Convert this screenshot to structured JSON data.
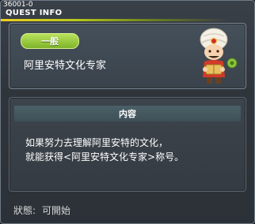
{
  "window": {
    "quest_id": "36001-0",
    "title": "QUEST INFO"
  },
  "header": {
    "badge": "一般",
    "quest_name": "阿里安特文化专家",
    "npc_icon": "turbaned-merchant-npc-icon"
  },
  "content": {
    "header": "内容",
    "lines": [
      "如果努力去理解阿里安特的文化，",
      "就能获得<阿里安特文化专家>称号。"
    ]
  },
  "status": {
    "label": "狀態:",
    "value": "可開始"
  },
  "colors": {
    "accent": "#8ec63f",
    "title_underline": "#e8c820",
    "panel_bg": "#3a434c"
  }
}
